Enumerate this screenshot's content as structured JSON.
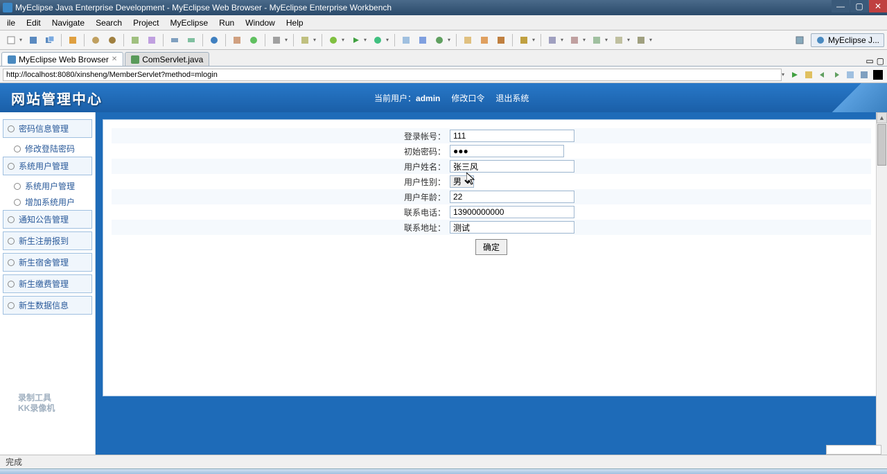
{
  "window": {
    "title": "MyEclipse Java Enterprise Development - MyEclipse Web Browser - MyEclipse Enterprise Workbench"
  },
  "menu": [
    "ile",
    "Edit",
    "Navigate",
    "Search",
    "Project",
    "MyEclipse",
    "Run",
    "Window",
    "Help"
  ],
  "perspective": "MyEclipse J...",
  "tabs": [
    {
      "label": "MyEclipse Web Browser",
      "active": true
    },
    {
      "label": "ComServlet.java",
      "active": false
    }
  ],
  "url": "http://localhost:8080/xinsheng/MemberServlet?method=mlogin",
  "web": {
    "header_title": "网站管理中心",
    "current_user_label": "当前用户：",
    "current_user": "admin",
    "nav": [
      "修改口令",
      "退出系统"
    ]
  },
  "sidebar": [
    {
      "type": "group",
      "label": "密码信息管理"
    },
    {
      "type": "sub",
      "label": "修改登陆密码"
    },
    {
      "type": "group",
      "label": "系统用户管理"
    },
    {
      "type": "sub",
      "label": "系统用户管理"
    },
    {
      "type": "sub",
      "label": "增加系统用户"
    },
    {
      "type": "group",
      "label": "通知公告管理"
    },
    {
      "type": "group",
      "label": "新生注册报到"
    },
    {
      "type": "group",
      "label": "新生宿舍管理"
    },
    {
      "type": "group",
      "label": "新生缴费管理"
    },
    {
      "type": "group",
      "label": "新生数据信息"
    }
  ],
  "form": {
    "account_label": "登录帐号：",
    "account": "111",
    "password_label": "初始密码：",
    "password": "●●●",
    "name_label": "用户姓名：",
    "name": "张三风",
    "gender_label": "用户性别：",
    "gender": "男",
    "age_label": "用户年龄：",
    "age": "22",
    "phone_label": "联系电话：",
    "phone": "13900000000",
    "address_label": "联系地址：",
    "address": "测试",
    "submit": "确定"
  },
  "watermark": {
    "line1": "录制工具",
    "line2": "KK录像机"
  },
  "status": "完成"
}
